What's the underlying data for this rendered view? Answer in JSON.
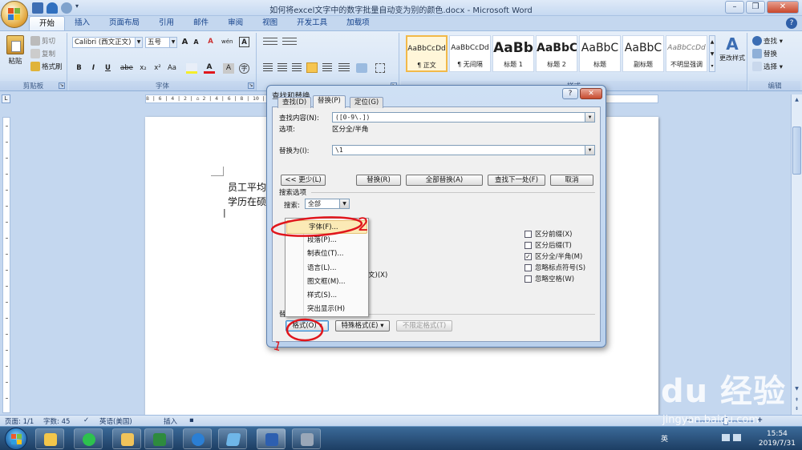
{
  "window": {
    "title": "如何将excel文字中的数字批量自动变为别的颜色.docx - Microsoft Word",
    "minimize": "–",
    "maximize": "❐",
    "close": "✕"
  },
  "tabs": [
    "开始",
    "插入",
    "页面布局",
    "引用",
    "邮件",
    "审阅",
    "视图",
    "开发工具",
    "加载项"
  ],
  "ribbon": {
    "clipboard": {
      "paste": "粘贴",
      "cut": "剪切",
      "copy": "复制",
      "format_painter": "格式刷",
      "label": "剪贴板"
    },
    "font": {
      "font_name": "Calibri (西文正文)",
      "font_size": "五号",
      "label": "字体",
      "bold": "B",
      "italic": "I",
      "underline": "U",
      "strike": "abe",
      "sub": "x₂",
      "sup": "x²",
      "case": "Aa",
      "grow": "A",
      "shrink": "A",
      "clear": "A",
      "wen": "wén",
      "border_a": "A"
    },
    "paragraph": {
      "label": "段落"
    },
    "styles": {
      "label": "样式",
      "items": [
        {
          "sample": "AaBbCcDd",
          "name": "¶ 正文"
        },
        {
          "sample": "AaBbCcDd",
          "name": "¶ 无间隔"
        },
        {
          "sample": "AaBb",
          "name": "标题 1"
        },
        {
          "sample": "AaBbC",
          "name": "标题 2"
        },
        {
          "sample": "AaBbC",
          "name": "标题"
        },
        {
          "sample": "AaBbC",
          "name": "副标题"
        },
        {
          "sample": "AaBbCcDd",
          "name": "不明显强调"
        }
      ],
      "change_styles": "更改样式"
    },
    "editing": {
      "find": "查找 ▾",
      "replace": "替换",
      "select": "选择 ▾",
      "label": "编辑"
    }
  },
  "ruler": "8 | 6 | 4 | 2 | ⌂ 2 | 4 | 6 | 8 | 10 | 12 | 14 | 16 | 18 | 20 | 22 | 24 | 26 | 28 | 30 | 32 | 34 | 36 | 38 |  △ 42 | 44 | 46 | 48",
  "document": {
    "line1": "员工平均",
    "line2": "学历在硕",
    "cursor": "|"
  },
  "status": {
    "page": "页面: 1/1",
    "words": "字数: 45",
    "language": "英语(美国)",
    "insert": "插入"
  },
  "dialog": {
    "title": "查找和替换",
    "help": "?",
    "close": "✕",
    "tabs": [
      "查找(D)",
      "替换(P)",
      "定位(G)"
    ],
    "find_label": "查找内容(N):",
    "find_value": "([0-9\\.])",
    "options_label": "选项:",
    "options_value": "区分全/半角",
    "replace_label": "替换为(I):",
    "replace_value": "\\1",
    "less_button": "<< 更少(L)",
    "replace_button": "替换(R)",
    "replace_all_button": "全部替换(A)",
    "find_next_button": "查找下一处(F)",
    "cancel_button": "取消",
    "search_options": "搜索选项",
    "search_label": "搜索:",
    "search_value": "全部",
    "hidden_fragment": "文)(X)",
    "checkboxes": [
      {
        "label": "区分前缀(X)",
        "checked": false
      },
      {
        "label": "区分后缀(T)",
        "checked": false
      },
      {
        "label": "区分全/半角(M)",
        "checked": true
      },
      {
        "label": "忽略标点符号(S)",
        "checked": false
      },
      {
        "label": "忽略空格(W)",
        "checked": false
      }
    ],
    "replace_section": "替换",
    "format_button": "格式(O) ▾",
    "special_button": "特殊格式(E) ▾",
    "no_format_button": "不限定格式(T)"
  },
  "format_menu": {
    "items": [
      "字体(F)...",
      "段落(P)...",
      "制表位(T)...",
      "语言(L)...",
      "图文框(M)...",
      "样式(S)...",
      "突出显示(H)"
    ],
    "highlighted_index": 0
  },
  "annotations": {
    "mark1": "1",
    "mark2": "2"
  },
  "watermark": {
    "brand": "Bai du 经验",
    "url": "jingyan.baidu.com"
  },
  "taskbar": {
    "time": "15:54",
    "date": "2019/7/31",
    "ime": "英"
  },
  "colors": {
    "ribbon_bg": "#d9e6f6",
    "tab_text": "#15428b",
    "menu_highlight": "#fbeab6",
    "annotation_red": "#e0161c"
  }
}
